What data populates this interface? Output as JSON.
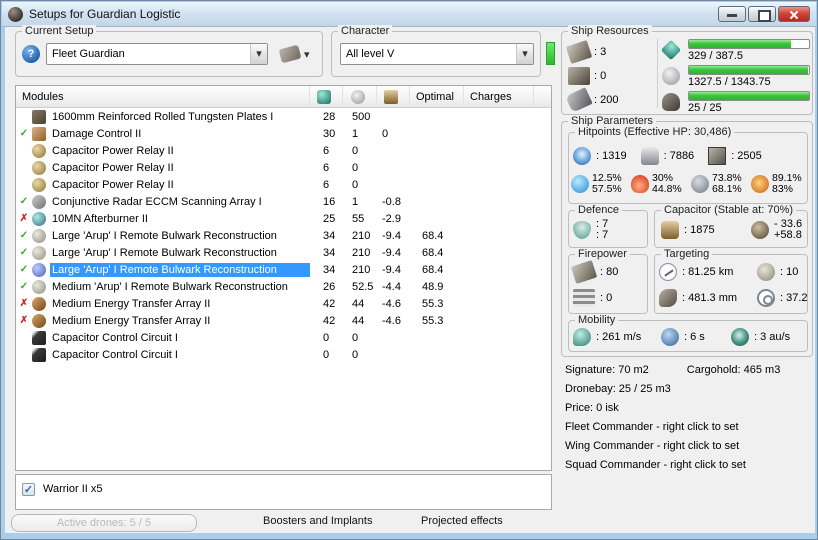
{
  "colors": {
    "selection": "#3399ff",
    "bar_green": "#3cc43c",
    "ok_green": "#3aa53a",
    "bad_red": "#cc2a2a"
  },
  "window": {
    "title": "Setups for Guardian Logistic"
  },
  "setup": {
    "group_label": "Current Setup",
    "value": "Fleet Guardian"
  },
  "character": {
    "group_label": "Character",
    "value": "All level V"
  },
  "modules_table": {
    "headers": {
      "name": "Modules",
      "optimal": "Optimal",
      "charges": "Charges"
    },
    "rows": [
      {
        "status": "",
        "icon": "plate",
        "name": "1600mm Reinforced Rolled Tungsten Plates I",
        "cpu": "28",
        "pg": "500",
        "cap": "",
        "optimal": "",
        "charges": "",
        "selected": false
      },
      {
        "status": "ok",
        "icon": "dc",
        "name": "Damage Control II",
        "cpu": "30",
        "pg": "1",
        "cap": "0",
        "optimal": "",
        "charges": "",
        "selected": false
      },
      {
        "status": "",
        "icon": "relay",
        "name": "Capacitor Power Relay II",
        "cpu": "6",
        "pg": "0",
        "cap": "",
        "optimal": "",
        "charges": "",
        "selected": false
      },
      {
        "status": "",
        "icon": "relay",
        "name": "Capacitor Power Relay II",
        "cpu": "6",
        "pg": "0",
        "cap": "",
        "optimal": "",
        "charges": "",
        "selected": false
      },
      {
        "status": "",
        "icon": "relay",
        "name": "Capacitor Power Relay II",
        "cpu": "6",
        "pg": "0",
        "cap": "",
        "optimal": "",
        "charges": "",
        "selected": false
      },
      {
        "status": "ok",
        "icon": "eccm",
        "name": "Conjunctive Radar ECCM Scanning Array I",
        "cpu": "16",
        "pg": "1",
        "cap": "-0.8",
        "optimal": "",
        "charges": "",
        "selected": false
      },
      {
        "status": "bad",
        "icon": "ab",
        "name": "10MN Afterburner II",
        "cpu": "25",
        "pg": "55",
        "cap": "-2.9",
        "optimal": "",
        "charges": "",
        "selected": false
      },
      {
        "status": "ok",
        "icon": "rr",
        "name": "Large 'Arup' I Remote Bulwark Reconstruction",
        "cpu": "34",
        "pg": "210",
        "cap": "-9.4",
        "optimal": "68.4",
        "charges": "",
        "selected": false
      },
      {
        "status": "ok",
        "icon": "rr",
        "name": "Large 'Arup' I Remote Bulwark Reconstruction",
        "cpu": "34",
        "pg": "210",
        "cap": "-9.4",
        "optimal": "68.4",
        "charges": "",
        "selected": false
      },
      {
        "status": "ok",
        "icon": "rrb",
        "name": "Large 'Arup' I Remote Bulwark Reconstruction",
        "cpu": "34",
        "pg": "210",
        "cap": "-9.4",
        "optimal": "68.4",
        "charges": "",
        "selected": true
      },
      {
        "status": "ok",
        "icon": "rr",
        "name": "Medium 'Arup' I Remote Bulwark Reconstruction",
        "cpu": "26",
        "pg": "52.5",
        "cap": "-4.4",
        "optimal": "48.9",
        "charges": "",
        "selected": false
      },
      {
        "status": "bad",
        "icon": "et",
        "name": "Medium Energy Transfer Array II",
        "cpu": "42",
        "pg": "44",
        "cap": "-4.6",
        "optimal": "55.3",
        "charges": "",
        "selected": false
      },
      {
        "status": "bad",
        "icon": "et",
        "name": "Medium Energy Transfer Array II",
        "cpu": "42",
        "pg": "44",
        "cap": "-4.6",
        "optimal": "55.3",
        "charges": "",
        "selected": false
      },
      {
        "status": "",
        "icon": "rig",
        "name": "Capacitor Control Circuit I",
        "cpu": "0",
        "pg": "0",
        "cap": "",
        "optimal": "",
        "charges": "",
        "selected": false
      },
      {
        "status": "",
        "icon": "rig",
        "name": "Capacitor Control Circuit I",
        "cpu": "0",
        "pg": "0",
        "cap": "",
        "optimal": "",
        "charges": "",
        "selected": false
      }
    ]
  },
  "drones": {
    "item_label": "Warrior II x5",
    "checked": true
  },
  "bottom": {
    "active_drones": "Active drones: 5 / 5",
    "boosters": "Boosters and Implants",
    "projected": "Projected effects"
  },
  "ship_resources": {
    "group_label": "Ship Resources",
    "turrets": ": 3",
    "launchers": ": 0",
    "calibration": ": 200",
    "cpu": {
      "text": "329 / 387.5",
      "pct": 85
    },
    "powergrid": {
      "text": "1327.5 / 1343.75",
      "pct": 99
    },
    "drone_bandwidth": {
      "text": "25 / 25",
      "pct": 100
    }
  },
  "ship_parameters": {
    "group_label": "Ship Parameters",
    "hitpoints": {
      "label": "Hitpoints (Effective HP: 30,486)",
      "shield": ": 1319",
      "armor": ": 7886",
      "hull": ": 2505",
      "resists": [
        {
          "name": "em",
          "top": "12.5%",
          "bottom": "57.5%"
        },
        {
          "name": "thermal",
          "top": "30%",
          "bottom": "44.8%"
        },
        {
          "name": "kinetic",
          "top": "73.8%",
          "bottom": "68.1%"
        },
        {
          "name": "explosive",
          "top": "89.1%",
          "bottom": "83%"
        }
      ]
    },
    "defence": {
      "label": "Defence",
      "top": ": 7",
      "bottom": ": 7"
    },
    "capacitor": {
      "label": "Capacitor (Stable at: 70%)",
      "amount": ": 1875",
      "drain": "- 33.6",
      "recharge": "+58.8"
    },
    "firepower": {
      "label": "Firepower",
      "turret": ": 80",
      "missile": ": 0"
    },
    "targeting": {
      "label": "Targeting",
      "range": ": 81.25 km",
      "max_targets": ": 10",
      "scan_resolution": ": 481.3 mm",
      "sensor_strength": ": 37.2"
    },
    "mobility": {
      "label": "Mobility",
      "speed": ": 261 m/s",
      "align_time": ": 6 s",
      "warp_speed": ": 3 au/s"
    }
  },
  "info": {
    "signature": "Signature: 70 m2",
    "cargohold": "Cargohold: 465 m3",
    "dronebay": "Dronebay: 25 / 25 m3",
    "price": "Price: 0 isk",
    "fleet_commander": "Fleet Commander - right click to set",
    "wing_commander": "Wing Commander - right click to set",
    "squad_commander": "Squad Commander - right click to set"
  }
}
